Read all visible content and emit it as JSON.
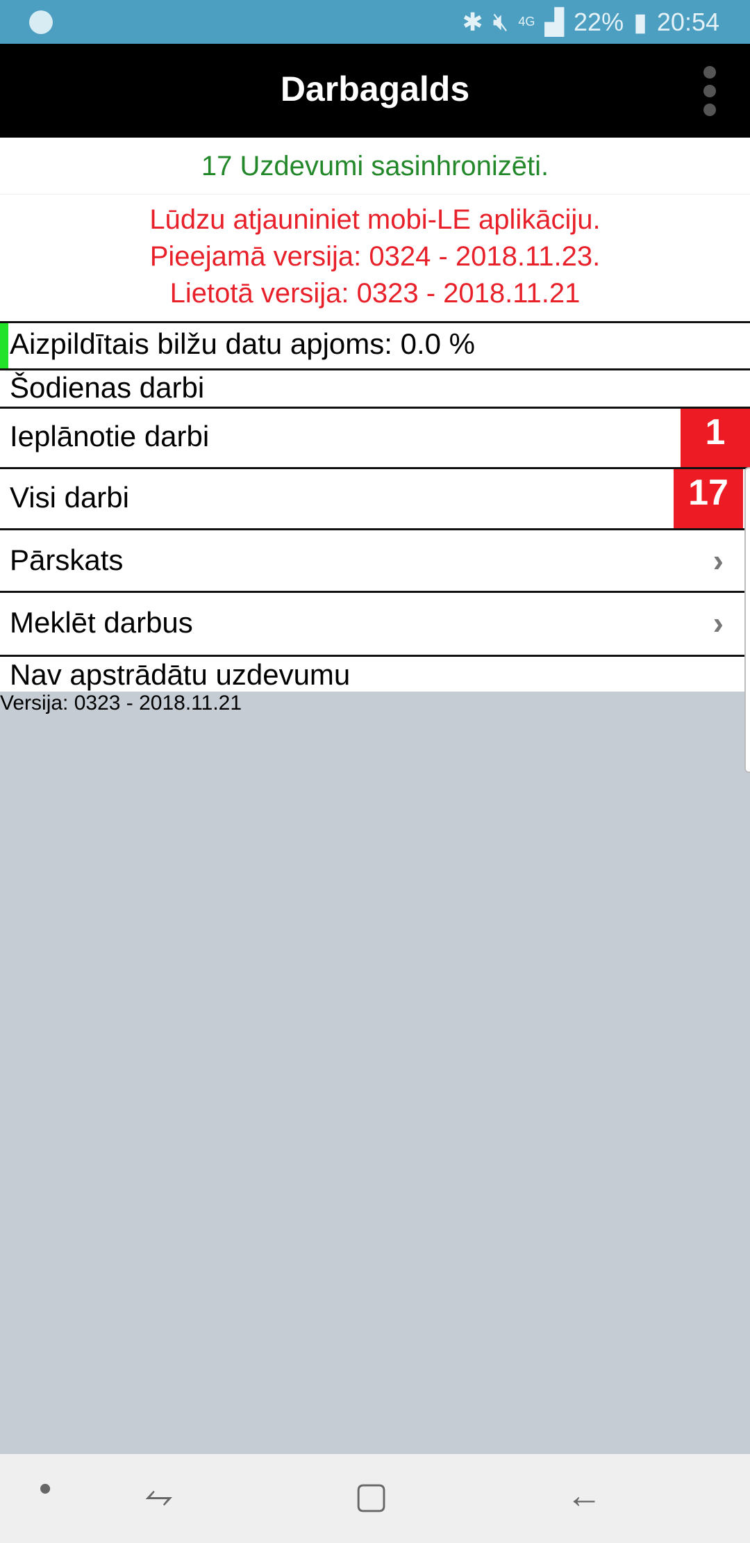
{
  "status": {
    "battery": "22%",
    "time": "20:54",
    "network": "4G"
  },
  "appbar": {
    "title": "Darbagalds"
  },
  "sync_message": "17 Uzdevumi sasinhronizēti.",
  "update": {
    "line1": "Lūdzu atjauniniet mobi-LE aplikāciju.",
    "line2": "Pieejamā versija: 0324 - 2018.11.23.",
    "line3": "Lietotā versija: 0323 - 2018.11.21"
  },
  "storage": {
    "label": "Aizpildītais bilžu datu apjoms: 0.0 %",
    "percent": 0.0
  },
  "items": {
    "today": "Šodienas darbi",
    "planned": "Ieplānotie darbi",
    "planned_count": "1",
    "all": "Visi darbi",
    "all_count": "17",
    "overview": "Pārskats",
    "search": "Meklēt darbus",
    "none": "Nav apstrādātu uzdevumu"
  },
  "version": "Versija: 0323 - 2018.11.21"
}
